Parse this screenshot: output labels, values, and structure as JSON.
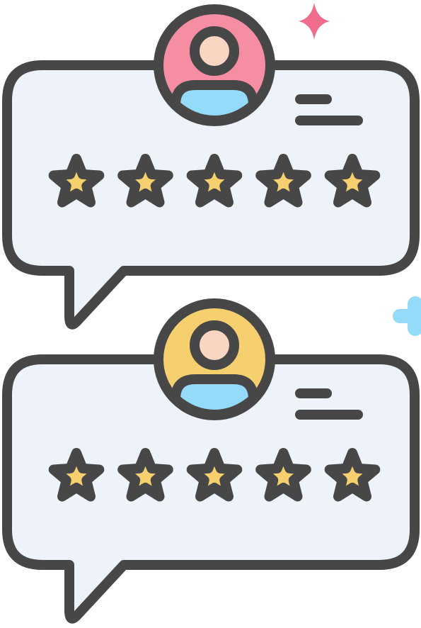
{
  "colors": {
    "outline": "#474747",
    "bubble_fill": "#eef3fa",
    "star_fill": "#f6d06f",
    "skin": "#f8d6c2",
    "shirt": "#93dbf8",
    "avatar_top_bg": "#f58ea2",
    "avatar_bottom_bg": "#f6d06f",
    "sparkle_pink": "#f06c8c",
    "sparkle_blue": "#93dbf8"
  },
  "reviews": [
    {
      "avatar_color": "#f58ea2",
      "rating": 5,
      "max_rating": 5
    },
    {
      "avatar_color": "#f6d06f",
      "rating": 5,
      "max_rating": 5
    }
  ],
  "icons": {
    "avatar": "user-avatar-icon",
    "star": "star-icon",
    "text_lines": "text-lines-icon",
    "sparkle": "sparkle-icon",
    "plus": "plus-icon"
  }
}
